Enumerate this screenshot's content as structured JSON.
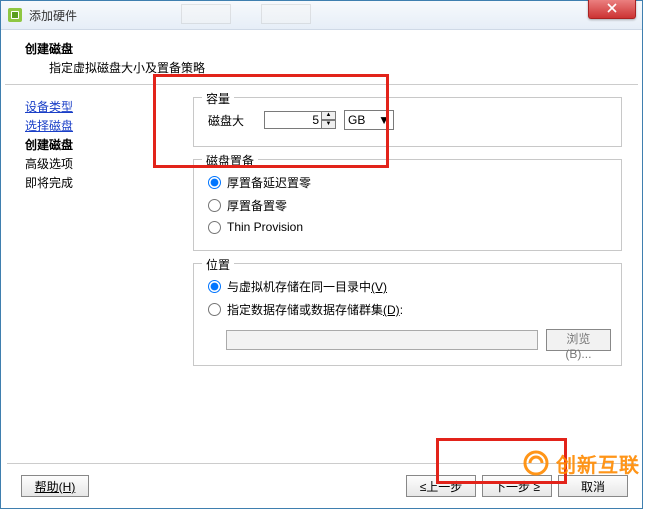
{
  "window": {
    "title": "添加硬件"
  },
  "header": {
    "title": "创建磁盘",
    "subtitle": "指定虚拟磁盘大小及置备策略"
  },
  "sidebar": {
    "items": [
      {
        "label": "设备类型",
        "kind": "link"
      },
      {
        "label": "选择磁盘",
        "kind": "link"
      },
      {
        "label": "创建磁盘",
        "kind": "current"
      },
      {
        "label": "高级选项",
        "kind": "plain"
      },
      {
        "label": "即将完成",
        "kind": "plain"
      }
    ]
  },
  "capacity": {
    "legend": "容量",
    "label": "磁盘大",
    "value": "5",
    "unit": "GB"
  },
  "provision": {
    "legend": "磁盘置备",
    "options": [
      {
        "label": "厚置备延迟置零",
        "checked": true
      },
      {
        "label": "厚置备置零",
        "checked": false
      },
      {
        "label": "Thin Provision",
        "checked": false
      }
    ]
  },
  "location": {
    "legend": "位置",
    "options": [
      {
        "label": "与虚拟机存储在同一目录中",
        "accel": "(V)",
        "checked": true
      },
      {
        "label": "指定数据存储或数据存储群集",
        "accel": "(D)",
        "checked": false
      }
    ],
    "browse": "浏览(B)...",
    "path": ""
  },
  "footer": {
    "help": "帮助(H)",
    "back": "≤上一步",
    "next": "下一步",
    "cancel": "取消"
  }
}
